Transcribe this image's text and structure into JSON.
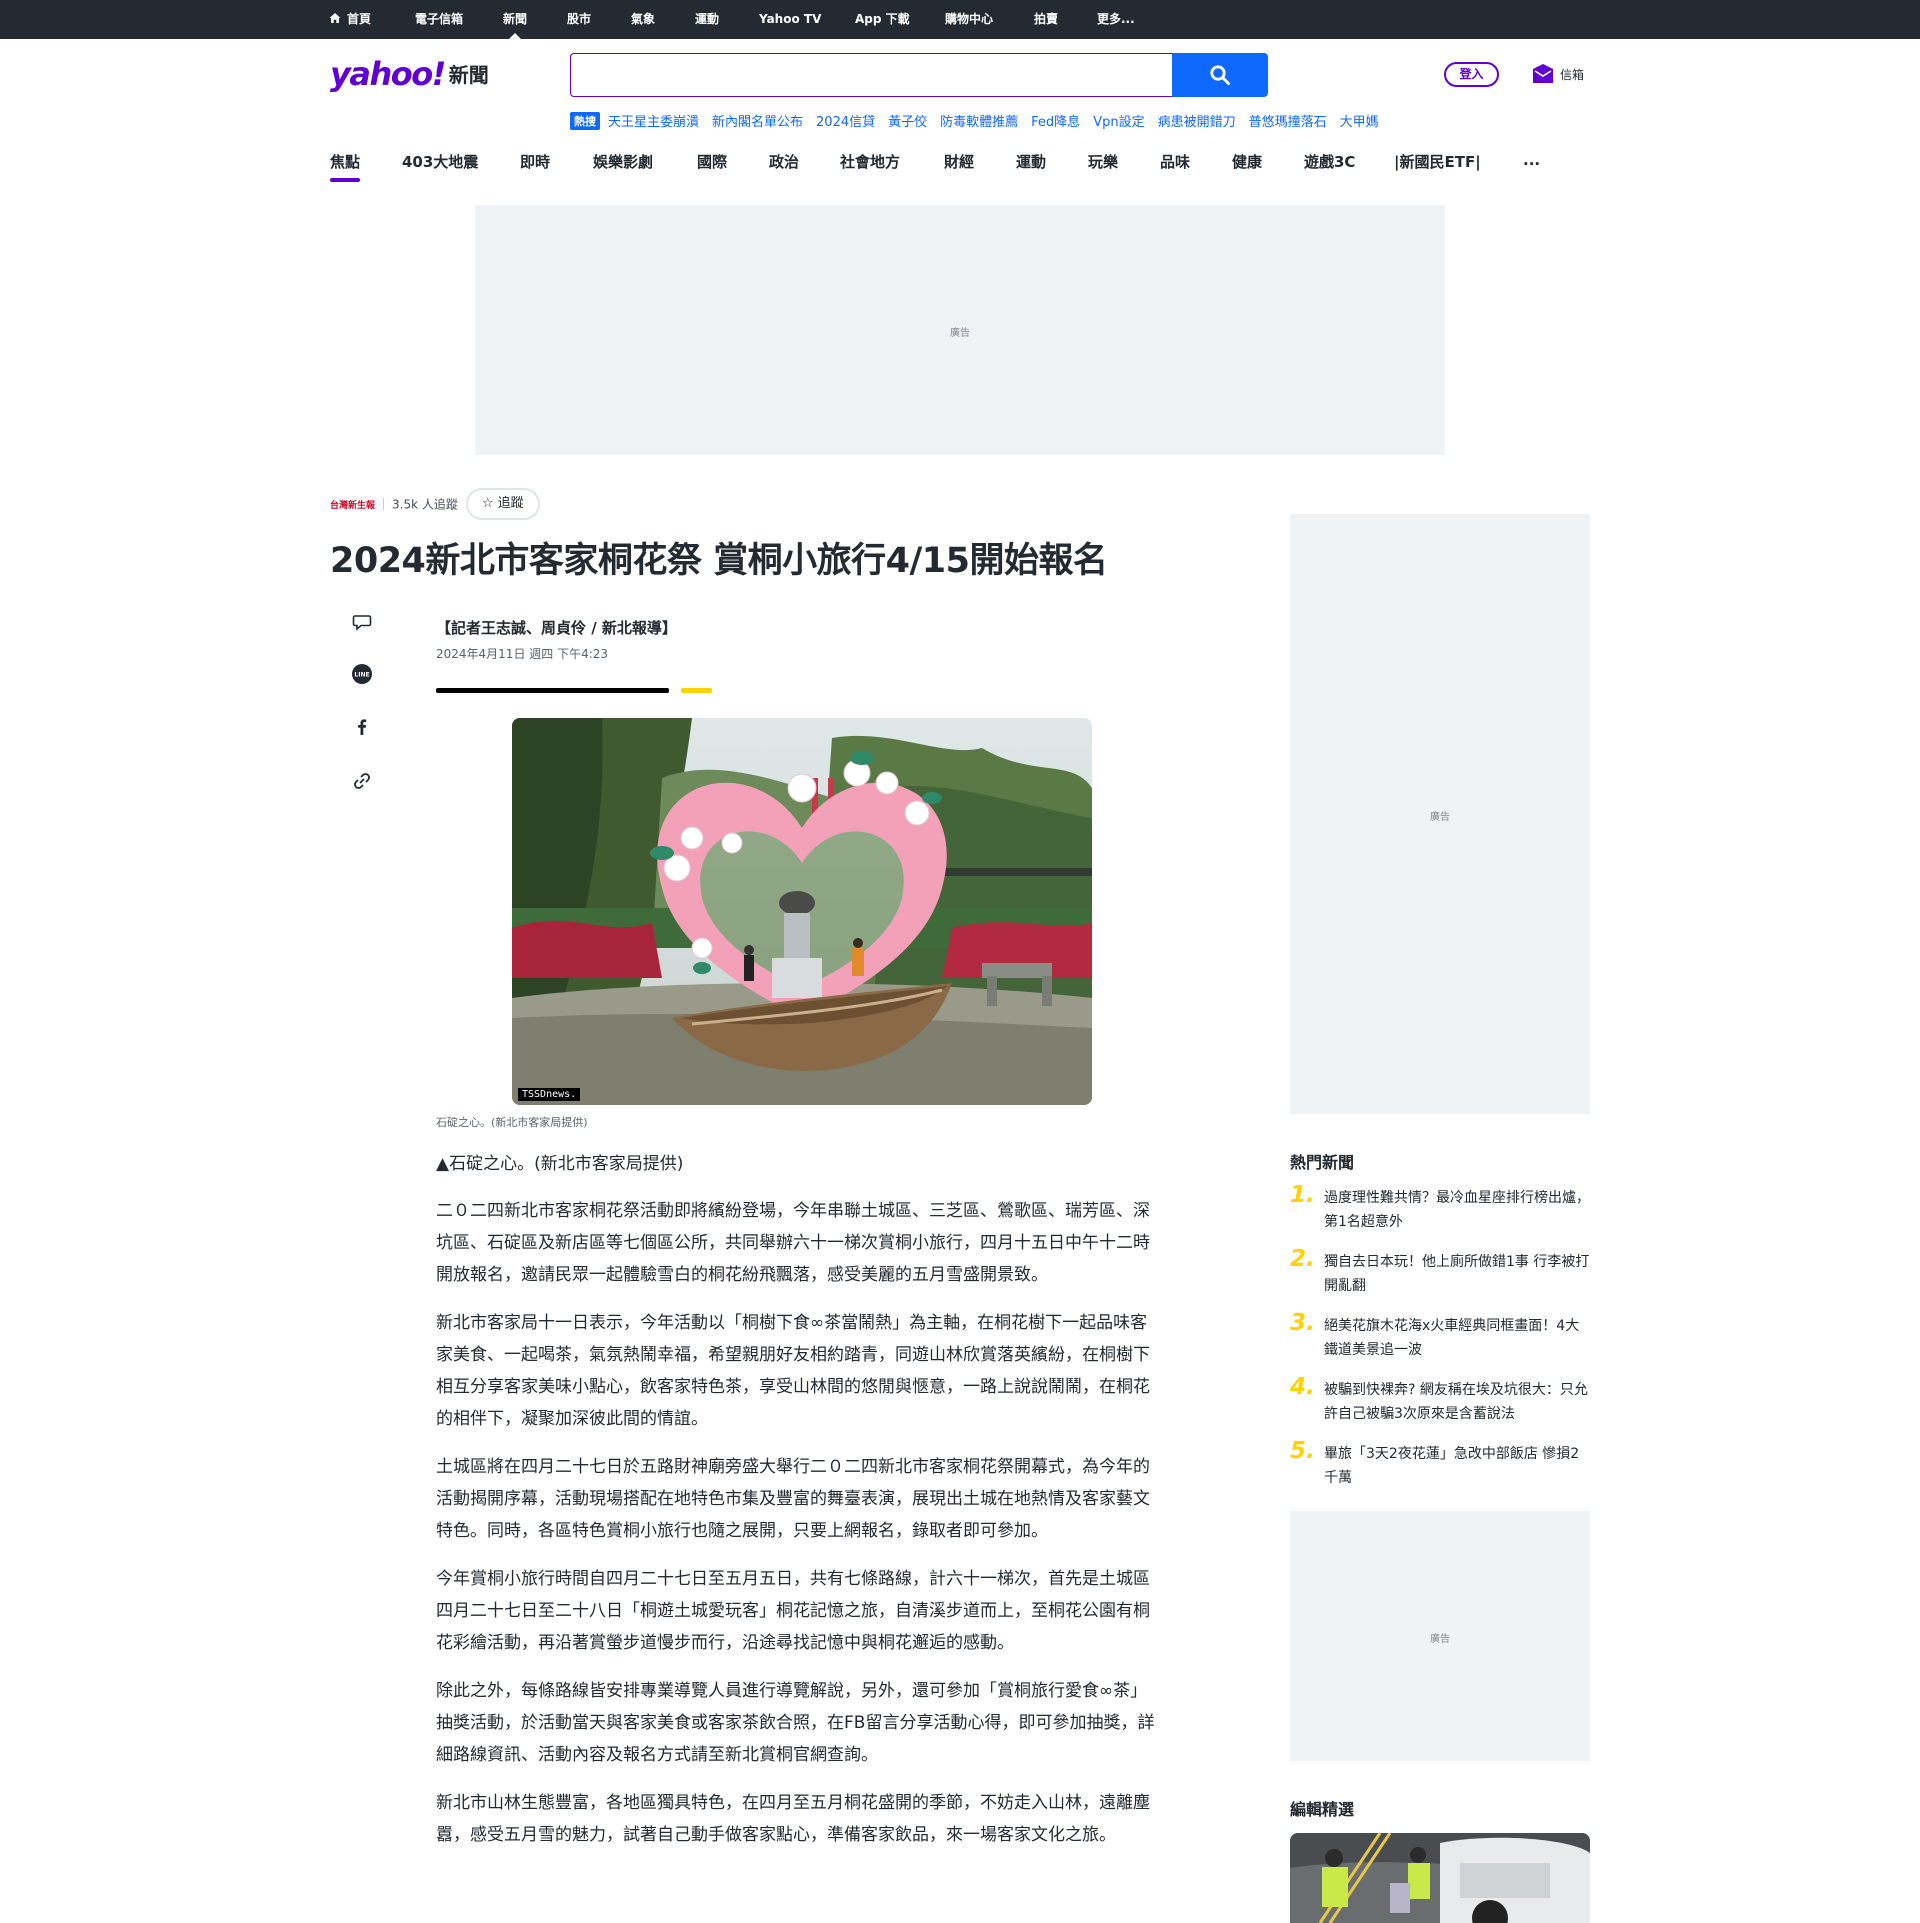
{
  "topbar": {
    "items": [
      {
        "label": "首頁",
        "icon": "home-icon"
      },
      {
        "label": "電子信箱"
      },
      {
        "label": "新聞",
        "active": true
      },
      {
        "label": "股市"
      },
      {
        "label": "氣象"
      },
      {
        "label": "運動"
      },
      {
        "label": "Yahoo TV"
      },
      {
        "label": "App 下載"
      },
      {
        "label": "購物中心"
      },
      {
        "label": "拍賣"
      },
      {
        "label": "更多..."
      }
    ]
  },
  "header": {
    "logo_text": "yahoo!",
    "logo_section": "新聞",
    "search": {
      "value": "",
      "placeholder": ""
    },
    "login_label": "登入",
    "mail_label": "信箱"
  },
  "trending": {
    "tag": "熱搜",
    "items": [
      "天王星主委崩潰",
      "新內閣名單公布",
      "2024信貸",
      "黃子佼",
      "防毒軟體推薦",
      "Fed降息",
      "Vpn設定",
      "病患被開錯刀",
      "普悠瑪撞落石",
      "大甲媽"
    ]
  },
  "categories": [
    {
      "label": "焦點",
      "active": true
    },
    {
      "label": "403大地震"
    },
    {
      "label": "即時"
    },
    {
      "label": "娛樂影劇"
    },
    {
      "label": "國際"
    },
    {
      "label": "政治"
    },
    {
      "label": "社會地方"
    },
    {
      "label": "財經"
    },
    {
      "label": "運動"
    },
    {
      "label": "玩樂"
    },
    {
      "label": "品味"
    },
    {
      "label": "健康"
    },
    {
      "label": "遊戲3C"
    },
    {
      "label": "|新國民ETF|"
    },
    {
      "label": "..."
    }
  ],
  "ads": {
    "label": "廣告"
  },
  "article": {
    "provider_logo_text": "台灣新生報",
    "followers": "3.5k 人追蹤",
    "follow_label": "☆ 追蹤",
    "title": "2024新北市客家桐花祭 賞桐小旅行4/15開始報名",
    "byline": "【記者王志誠、周貞伶 / 新北報導】",
    "date": "2024年4月11日 週四 下午4:23",
    "image_watermark": "TSSDnews.",
    "caption": "石碇之心。(新北市客家局提供)",
    "lead": "▲石碇之心。(新北市客家局提供)",
    "paragraphs": [
      "二０二四新北市客家桐花祭活動即將繽紛登場，今年串聯土城區、三芝區、鶯歌區、瑞芳區、深坑區、石碇區及新店區等七個區公所，共同舉辦六十一梯次賞桐小旅行，四月十五日中午十二時開放報名，邀請民眾一起體驗雪白的桐花紛飛飄落，感受美麗的五月雪盛開景致。",
      "新北市客家局十一日表示，今年活動以「桐樹下食∞茶當鬧熱」為主軸，在桐花樹下一起品味客家美食、一起喝茶，氣氛熱鬧幸福，希望親朋好友相約踏青，同遊山林欣賞落英繽紛，在桐樹下相互分享客家美味小點心，飲客家特色茶，享受山林間的悠閒與愜意，一路上說說鬧鬧，在桐花的相伴下，凝聚加深彼此間的情誼。",
      "土城區將在四月二十七日於五路財神廟旁盛大舉行二０二四新北市客家桐花祭開幕式，為今年的活動揭開序幕，活動現場搭配在地特色市集及豐富的舞臺表演，展現出土城在地熱情及客家藝文特色。同時，各區特色賞桐小旅行也隨之展開，只要上網報名，錄取者即可參加。",
      "今年賞桐小旅行時間自四月二十七日至五月五日，共有七條路線，計六十一梯次，首先是土城區四月二十七日至二十八日「桐遊土城愛玩客」桐花記憶之旅，自清溪步道而上，至桐花公園有桐花彩繪活動，再沿著賞螢步道慢步而行，沿途尋找記憶中與桐花邂逅的感動。",
      "除此之外，每條路線皆安排專業導覽人員進行導覽解說，另外，還可參加「賞桐旅行愛食∞茶」抽獎活動，於活動當天與客家美食或客家茶飲合照，在FB留言分享活動心得，即可參加抽獎，詳細路線資訊、活動內容及報名方式請至新北賞桐官網查詢。",
      "新北市山林生態豐富，各地區獨具特色，在四月至五月桐花盛開的季節，不妨走入山林，遠離塵囂，感受五月雪的魅力，試著自己動手做客家點心，準備客家飲品，來一場客家文化之旅。"
    ]
  },
  "sidebar": {
    "hot_title": "熱門新聞",
    "hot_items": [
      {
        "num": "1.",
        "text": "過度理性難共情？最冷血星座排行榜出爐，第1名超意外"
      },
      {
        "num": "2.",
        "text": "獨自去日本玩！他上廁所做錯1事 行李被打開亂翻"
      },
      {
        "num": "3.",
        "text": "絕美花旗木花海x火車經典同框畫面！4大鐵道美景追一波"
      },
      {
        "num": "4.",
        "text": "被騙到快裸奔? 網友稱在埃及坑很大：只允許自己被騙3次原來是含蓄說法"
      },
      {
        "num": "5.",
        "text": "畢旅「3天2夜花蓮」急改中部飯店 慘損2千萬"
      }
    ],
    "editor_title": "編輯精選"
  },
  "colors": {
    "brand": "#6001d2",
    "link": "#0f69ff",
    "rank": "#ffd200",
    "topbar_bg": "#232a31",
    "ad_bg": "#f0f3f5"
  }
}
